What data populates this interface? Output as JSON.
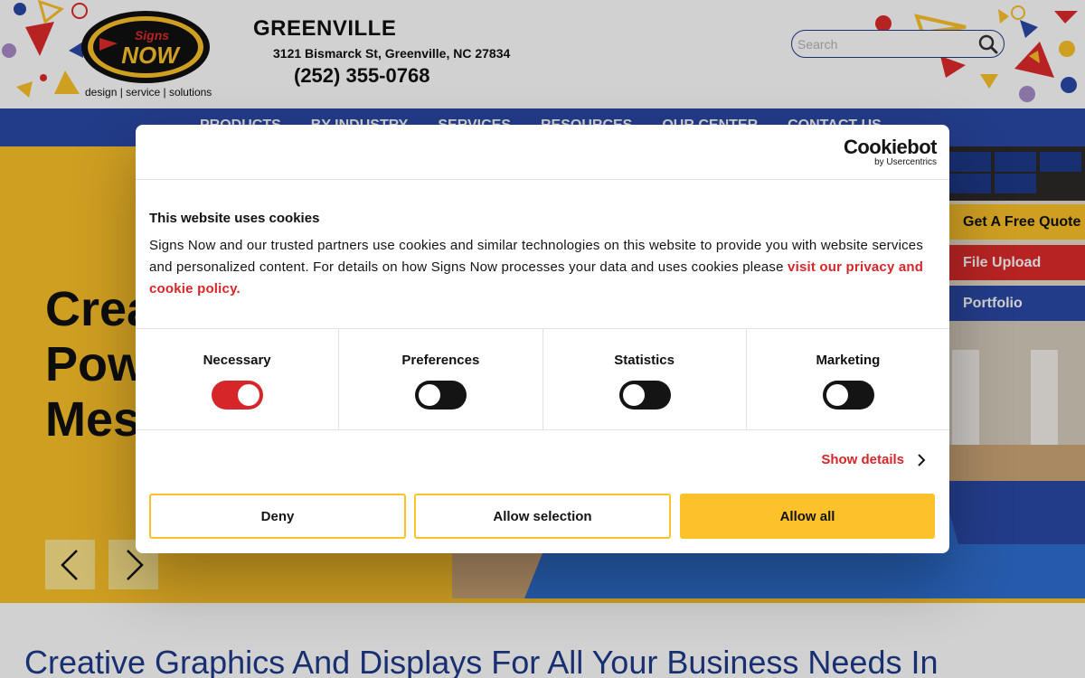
{
  "header": {
    "logo_text": "Signs Now",
    "logo_tagline": "design | service | solutions",
    "city": "GREENVILLE",
    "address": "3121 Bismarck St, Greenville, NC 27834",
    "phone": "(252) 355-0768",
    "search_placeholder": "Search"
  },
  "nav": {
    "items": [
      "PRODUCTS",
      "BY INDUSTRY",
      "SERVICES",
      "RESOURCES",
      "OUR CENTER",
      "CONTACT US"
    ]
  },
  "hero": {
    "title_lines": [
      "Crea",
      "Pow",
      "Mes"
    ],
    "side_actions": [
      "Get A Free Quote",
      "File Upload",
      "Portfolio"
    ]
  },
  "bottom_heading": "Creative Graphics And Displays For All Your Business Needs In",
  "cookie_dialog": {
    "brand": "Cookiebot",
    "brand_sub": "by Usercentrics",
    "title": "This website uses cookies",
    "body": "Signs Now and our trusted partners use cookies and similar technologies on this website to provide you with website services and personalized content. For details on how Signs Now processes your data and uses cookies please ",
    "link_text": "visit our privacy and cookie policy.",
    "categories": [
      {
        "label": "Necessary",
        "enabled": true
      },
      {
        "label": "Preferences",
        "enabled": false
      },
      {
        "label": "Statistics",
        "enabled": false
      },
      {
        "label": "Marketing",
        "enabled": false
      }
    ],
    "show_details": "Show details",
    "buttons": {
      "deny": "Deny",
      "allow_selection": "Allow selection",
      "allow_all": "Allow all"
    }
  },
  "colors": {
    "brand_yellow": "#fdc22a",
    "nav_blue": "#2b4aa8",
    "accent_red": "#d6262a",
    "heading_blue": "#1e3a8a"
  }
}
